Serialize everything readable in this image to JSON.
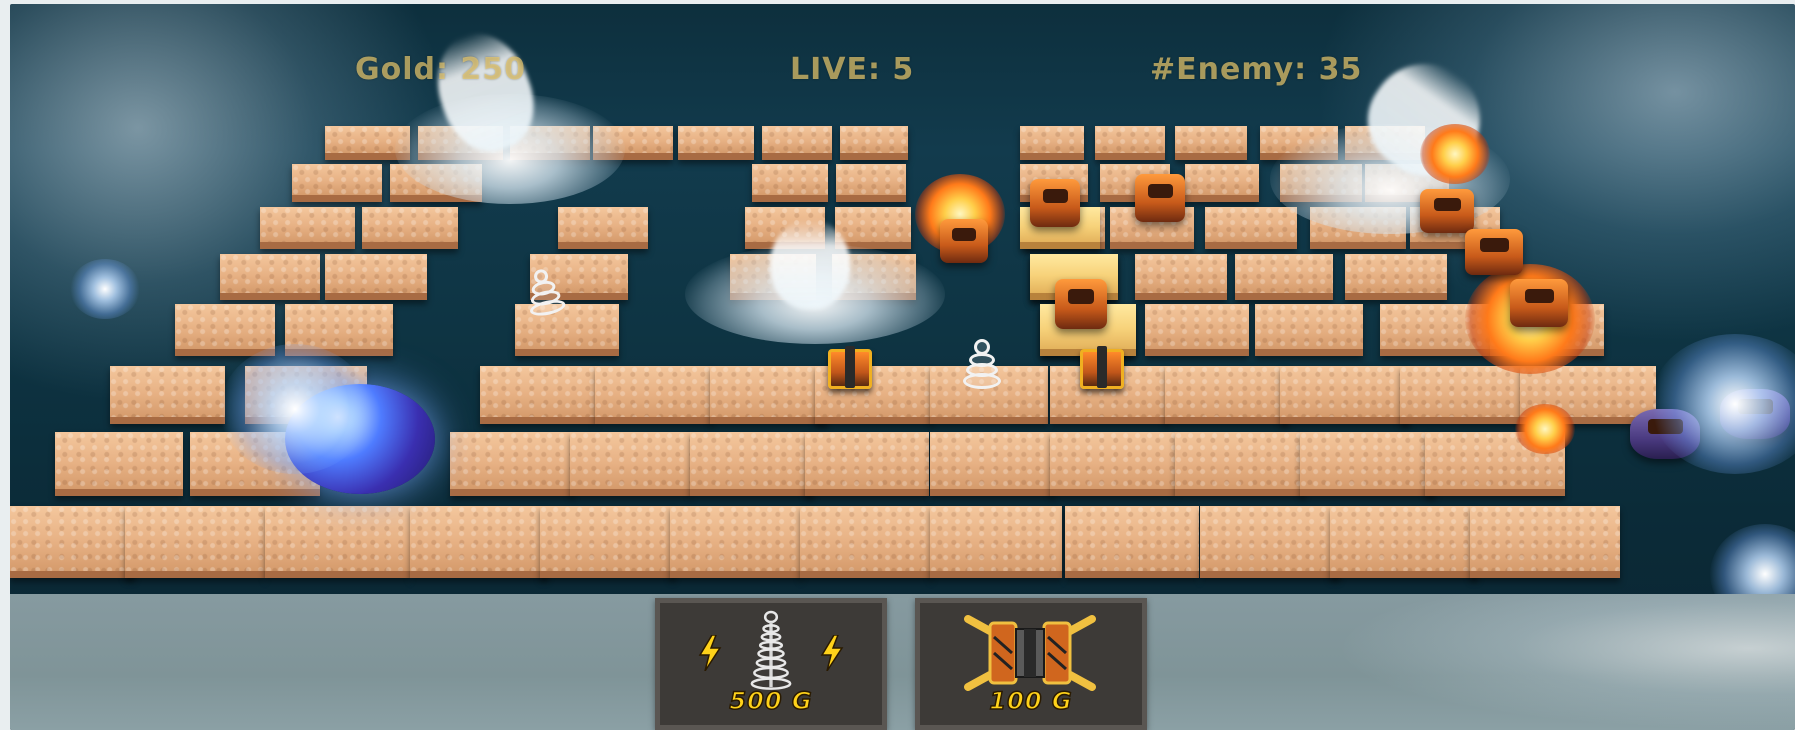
{
  "hud": {
    "gold": "Gold: 250",
    "lives": "LIVE: 5",
    "enemies": "#Enemy: 35"
  },
  "shop": {
    "items": [
      {
        "name": "tesla-tower",
        "price": "500 G",
        "icon": "tesla-coil-icon"
      },
      {
        "name": "cannon-tower",
        "price": "100 G",
        "icon": "cannon-turret-icon"
      }
    ]
  },
  "colors": {
    "hud_text": "#e6c86e",
    "price_text": "#ffd21a",
    "tile": "#e7b184",
    "sea": "#0e3443"
  }
}
